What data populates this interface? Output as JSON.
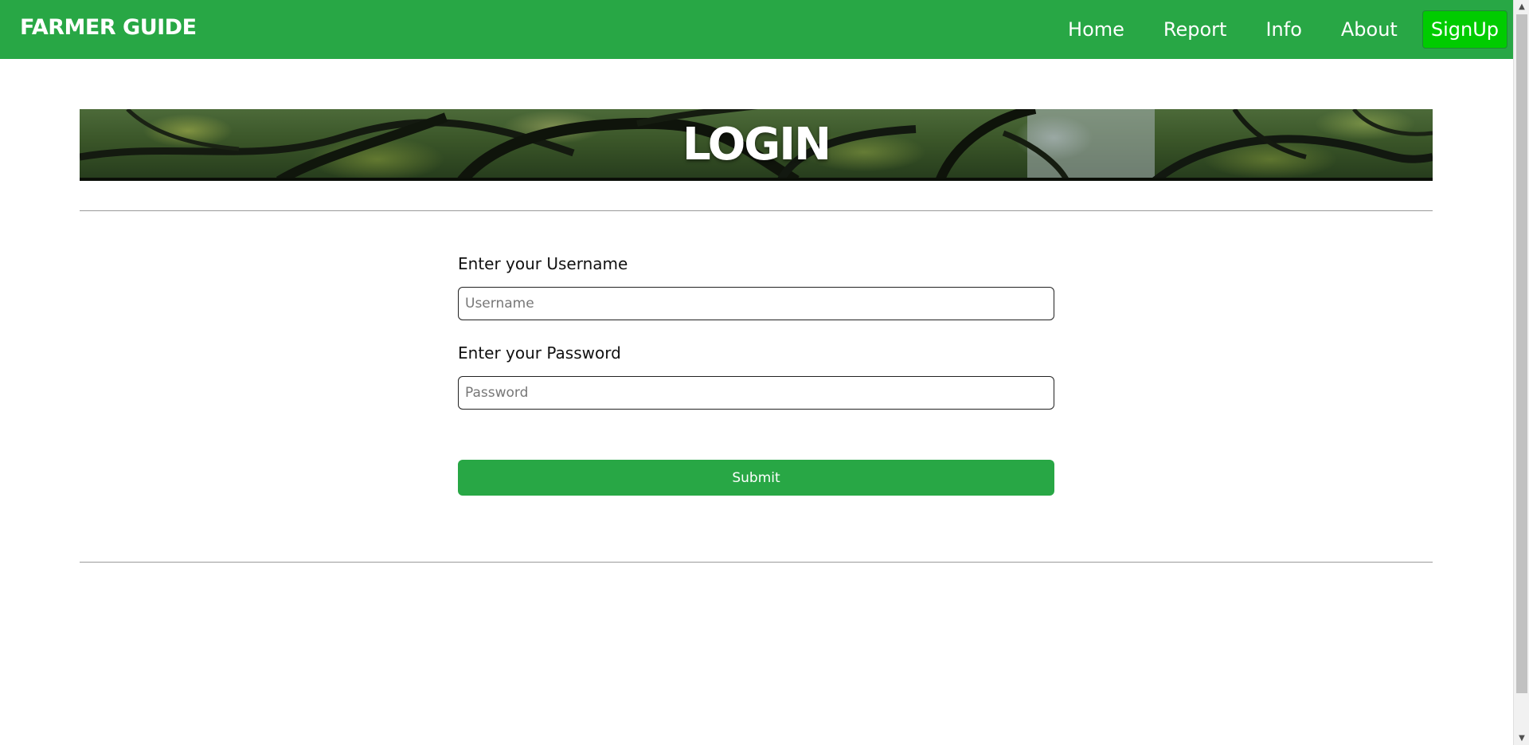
{
  "navbar": {
    "brand": "FARMER GUIDE",
    "links": [
      {
        "label": "Home"
      },
      {
        "label": "Report"
      },
      {
        "label": "Info"
      },
      {
        "label": "About"
      }
    ],
    "signup_label": "SignUp",
    "colors": {
      "background": "#28a745",
      "signup": "#00cc00"
    }
  },
  "banner": {
    "title": "LOGIN"
  },
  "form": {
    "username_label": "Enter your Username",
    "username_placeholder": "Username",
    "username_value": "",
    "password_label": "Enter your Password",
    "password_placeholder": "Password",
    "password_value": "",
    "submit_label": "Submit",
    "submit_color": "#28a745"
  },
  "scrollbar": {
    "up_icon": "triangle-up-icon",
    "down_icon": "triangle-down-icon"
  }
}
